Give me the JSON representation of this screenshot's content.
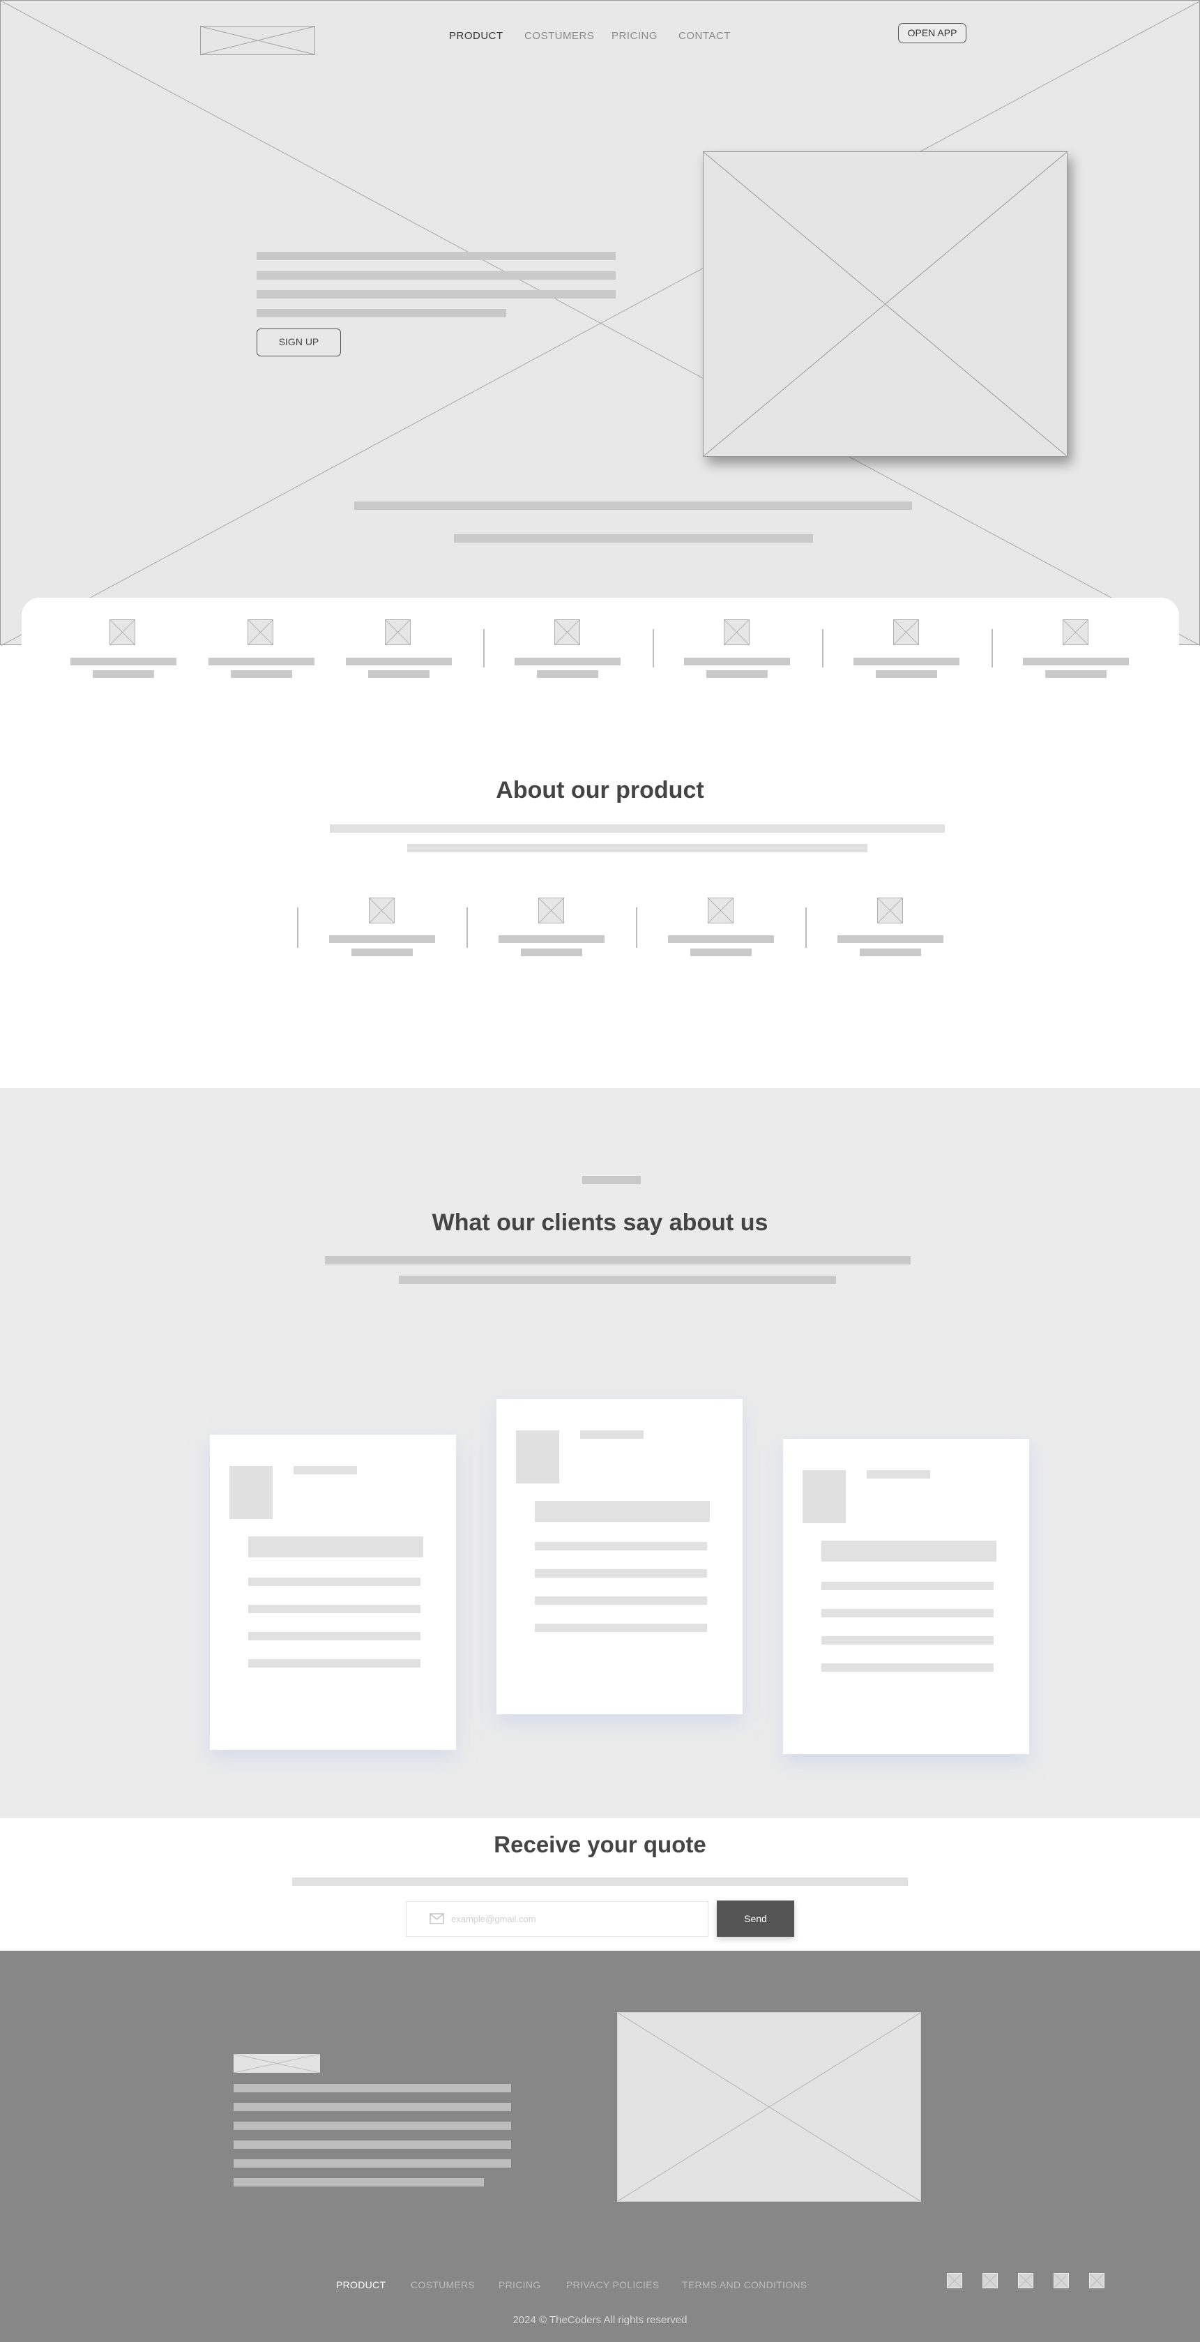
{
  "nav": {
    "items": [
      {
        "label": "PRODUCT",
        "active": true
      },
      {
        "label": "COSTUMERS",
        "active": false
      },
      {
        "label": "PRICING",
        "active": false
      },
      {
        "label": "CONTACT",
        "active": false
      }
    ],
    "open_app_label": "OPEN APP"
  },
  "hero": {
    "signup_label": "SIGN UP"
  },
  "about": {
    "title": "About our product"
  },
  "clients": {
    "title": "What our clients say about us"
  },
  "quote": {
    "title": "Receive your quote",
    "email_placeholder": "example@gmail.com",
    "send_label": "Send"
  },
  "footer": {
    "links": [
      {
        "label": "PRODUCT",
        "active": true
      },
      {
        "label": "COSTUMERS",
        "active": false
      },
      {
        "label": "PRICING",
        "active": false
      },
      {
        "label": "PRIVACY POLICIES",
        "active": false
      },
      {
        "label": "TERMS AND CONDITIONS",
        "active": false
      }
    ],
    "copyright": "2024 © TheCoders All rights reserved"
  },
  "colors": {
    "hero_bg": "#e8e8e8",
    "section_gray": "#ebebeb",
    "footer_bg": "#878787",
    "heading": "#444444",
    "button_dark": "#545454"
  },
  "icons": [
    "image-placeholder-icon",
    "feature-icon",
    "mail-icon",
    "social-icon"
  ]
}
